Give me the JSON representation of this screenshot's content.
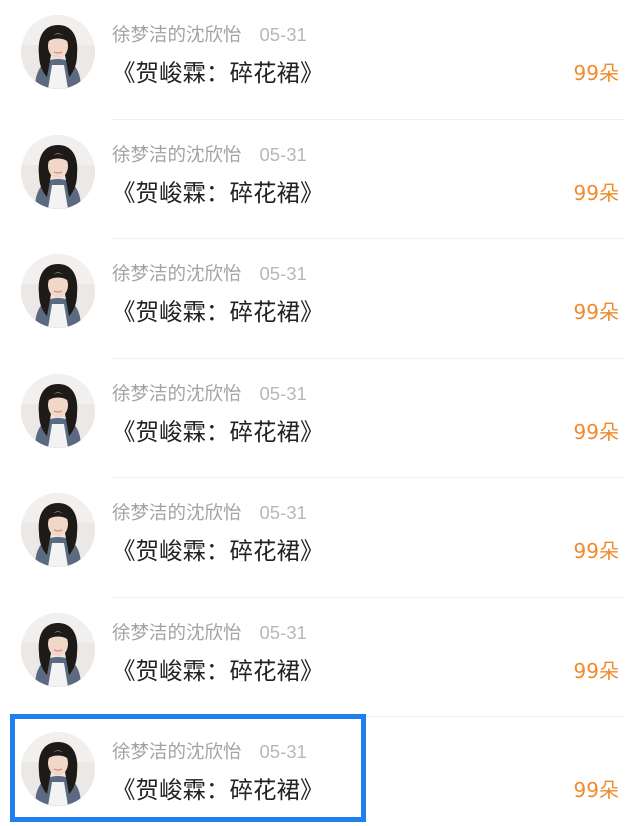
{
  "items": [
    {
      "author": "徐梦洁的沈欣怡",
      "date": "05-31",
      "title": "《贺峻霖：碎花裙》",
      "gift": "99朵"
    },
    {
      "author": "徐梦洁的沈欣怡",
      "date": "05-31",
      "title": "《贺峻霖：碎花裙》",
      "gift": "99朵"
    },
    {
      "author": "徐梦洁的沈欣怡",
      "date": "05-31",
      "title": "《贺峻霖：碎花裙》",
      "gift": "99朵"
    },
    {
      "author": "徐梦洁的沈欣怡",
      "date": "05-31",
      "title": "《贺峻霖：碎花裙》",
      "gift": "99朵"
    },
    {
      "author": "徐梦洁的沈欣怡",
      "date": "05-31",
      "title": "《贺峻霖：碎花裙》",
      "gift": "99朵"
    },
    {
      "author": "徐梦洁的沈欣怡",
      "date": "05-31",
      "title": "《贺峻霖：碎花裙》",
      "gift": "99朵"
    },
    {
      "author": "徐梦洁的沈欣怡",
      "date": "05-31",
      "title": "《贺峻霖：碎花裙》",
      "gift": "99朵"
    }
  ],
  "colors": {
    "meta_text": "#a3a3a3",
    "title_text": "#222222",
    "gift_text": "#f08a2c",
    "highlight_border": "#1f7ff2",
    "divider": "#f1f1f1"
  },
  "icons": {
    "avatar": "user-photo-avatar"
  }
}
